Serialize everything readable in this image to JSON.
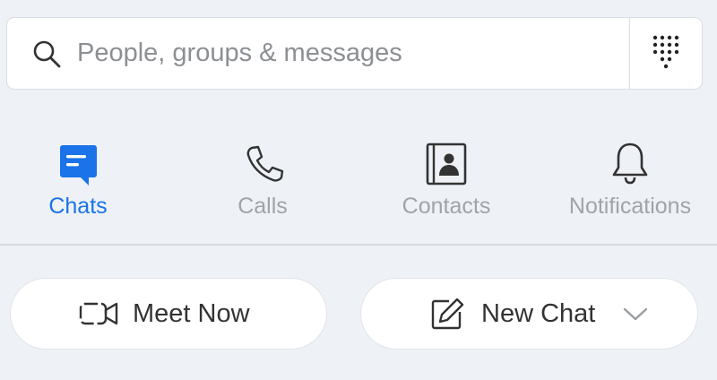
{
  "search": {
    "placeholder": "People, groups & messages",
    "value": "",
    "icon": "search-icon",
    "dialpad_icon": "dialpad-icon"
  },
  "tabs": [
    {
      "label": "Chats",
      "icon": "chat-icon",
      "active": true
    },
    {
      "label": "Calls",
      "icon": "phone-icon",
      "active": false
    },
    {
      "label": "Contacts",
      "icon": "contacts-icon",
      "active": false
    },
    {
      "label": "Notifications",
      "icon": "bell-icon",
      "active": false
    }
  ],
  "actions": {
    "meet_now": {
      "label": "Meet Now",
      "icon": "video-camera-icon"
    },
    "new_chat": {
      "label": "New Chat",
      "icon": "edit-icon",
      "dropdown_icon": "chevron-down-icon"
    }
  },
  "colors": {
    "accent": "#1a73e8",
    "background": "#eef1f6",
    "inactive_text": "#a0a3a8"
  }
}
